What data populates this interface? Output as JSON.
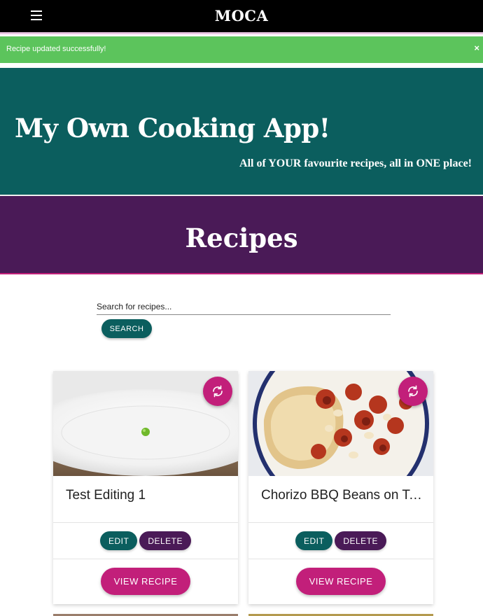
{
  "navbar": {
    "brand": "MOCA",
    "menu_icon": "hamburger-menu-icon"
  },
  "alert": {
    "message": "Recipe updated successfully!",
    "close": "×"
  },
  "hero": {
    "title": "My Own Cooking App!",
    "subtitle": "All of YOUR favourite recipes, all in ONE place!"
  },
  "section": {
    "title": "Recipes"
  },
  "search": {
    "placeholder": "Search for recipes...",
    "button": "SEARCH"
  },
  "cards": [
    {
      "title": "Test Editing 1",
      "edit": "EDIT",
      "delete": "DELETE",
      "view": "VIEW RECIPE",
      "image": "plate-with-single-pea",
      "icon": "refresh-icon"
    },
    {
      "title": "Chorizo BBQ Beans on Toast",
      "edit": "EDIT",
      "delete": "DELETE",
      "view": "VIEW RECIPE",
      "image": "chorizo-beans-on-toast",
      "icon": "refresh-icon"
    }
  ],
  "colors": {
    "teal": "#0b5e5e",
    "purple": "#4a1a57",
    "magenta": "#c21f7a",
    "success": "#5cc45c"
  }
}
